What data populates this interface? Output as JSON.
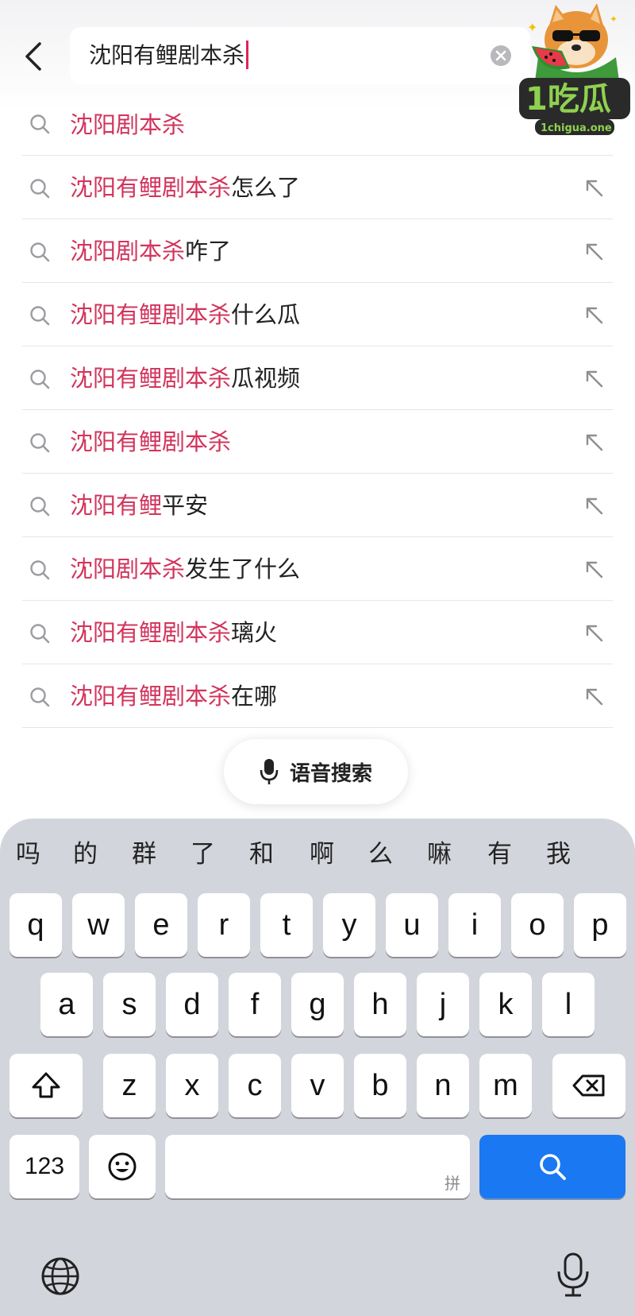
{
  "header": {
    "back_icon": "chevron-left-icon",
    "search_value": "沈阳有鲤剧本杀",
    "clear_icon": "clear-x-icon"
  },
  "logo": {
    "text": "1吃瓜",
    "url_text": "1chigua.one"
  },
  "suggestions": [
    {
      "highlight": "沈阳剧本杀",
      "rest": "",
      "has_arrow": false
    },
    {
      "highlight": "沈阳有鲤剧本杀",
      "rest": "怎么了",
      "has_arrow": true
    },
    {
      "highlight": "沈阳剧本杀",
      "rest": "咋了",
      "has_arrow": true
    },
    {
      "highlight": "沈阳有鲤剧本杀",
      "rest": "什么瓜",
      "has_arrow": true
    },
    {
      "highlight": "沈阳有鲤剧本杀",
      "rest": "瓜视频",
      "has_arrow": true
    },
    {
      "highlight": "沈阳有鲤剧本杀",
      "rest": "",
      "has_arrow": true
    },
    {
      "highlight": "沈阳有鲤",
      "rest": "平安",
      "has_arrow": true
    },
    {
      "highlight": "沈阳剧本杀",
      "rest": "发生了什么",
      "has_arrow": true
    },
    {
      "highlight": "沈阳有鲤剧本杀",
      "rest": "璃火",
      "has_arrow": true
    },
    {
      "highlight": "沈阳有鲤剧本杀",
      "rest": "在哪",
      "has_arrow": true
    }
  ],
  "voice_search": {
    "label": "语音搜索",
    "icon": "microphone-icon"
  },
  "keyboard": {
    "candidates": [
      "吗",
      "的",
      "群",
      "了",
      "和",
      "啊",
      "么",
      "嘛",
      "有",
      "我"
    ],
    "row1": [
      "q",
      "w",
      "e",
      "r",
      "t",
      "y",
      "u",
      "i",
      "o",
      "p"
    ],
    "row2": [
      "a",
      "s",
      "d",
      "f",
      "g",
      "h",
      "j",
      "k",
      "l"
    ],
    "row3": [
      "z",
      "x",
      "c",
      "v",
      "b",
      "n",
      "m"
    ],
    "numbers_label": "123",
    "space_hint": "拼",
    "shift_icon": "shift-arrow-icon",
    "delete_icon": "backspace-icon",
    "emoji_icon": "emoji-icon",
    "search_key_icon": "search-icon",
    "globe_icon": "globe-icon",
    "dictation_icon": "microphone-icon",
    "colors": {
      "highlight": "#d2345c",
      "search_key": "#1978f2",
      "keyboard_bg": "#d3d5dc"
    }
  }
}
